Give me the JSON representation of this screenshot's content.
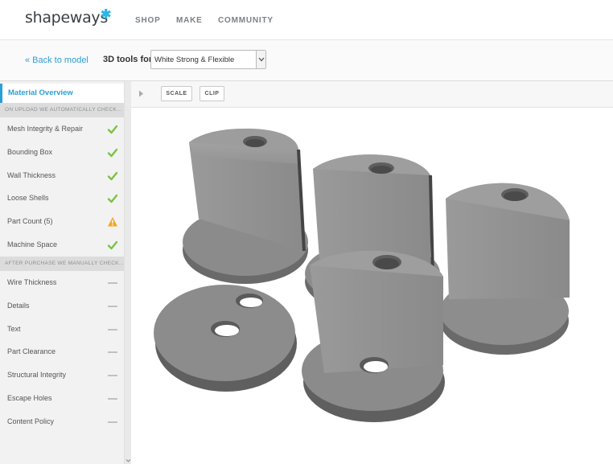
{
  "header": {
    "logo": "shapeways",
    "nav": [
      "SHOP",
      "MAKE",
      "COMMUNITY"
    ]
  },
  "subheader": {
    "back_label": "« Back to model",
    "tools_label": "3D tools for",
    "material_select": "White Strong & Flexible"
  },
  "sidebar": {
    "overview_label": "Material Overview",
    "auto_section": "ON UPLOAD WE AUTOMATICALLY CHECK...",
    "auto_checks": [
      {
        "label": "Mesh Integrity & Repair",
        "status": "pass"
      },
      {
        "label": "Bounding Box",
        "status": "pass"
      },
      {
        "label": "Wall Thickness",
        "status": "pass"
      },
      {
        "label": "Loose Shells",
        "status": "pass"
      },
      {
        "label": "Part Count (5)",
        "status": "warning"
      },
      {
        "label": "Machine Space",
        "status": "pass"
      }
    ],
    "manual_section": "AFTER PURCHASE WE MANUALLY CHECK...",
    "manual_checks": [
      {
        "label": "Wire Thickness",
        "status": "pending"
      },
      {
        "label": "Details",
        "status": "pending"
      },
      {
        "label": "Text",
        "status": "pending"
      },
      {
        "label": "Part Clearance",
        "status": "pending"
      },
      {
        "label": "Structural Integrity",
        "status": "pending"
      },
      {
        "label": "Escape Holes",
        "status": "pending"
      },
      {
        "label": "Content Policy",
        "status": "pending"
      }
    ]
  },
  "viewer": {
    "scale_label": "SCALE",
    "clip_label": "CLIP"
  },
  "colors": {
    "accent": "#2a9fd6",
    "pass": "#7dc242",
    "warning": "#f5a623",
    "pending": "#b5b5b5",
    "model_side": "#8c8c8c",
    "model_top": "#999999"
  }
}
